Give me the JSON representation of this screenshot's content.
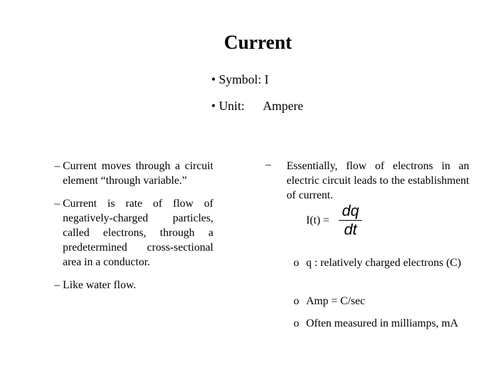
{
  "slide": {
    "title": "Current",
    "top_bullets": [
      {
        "marker": "•",
        "text": "Symbol: I"
      },
      {
        "marker": "•",
        "label": "Unit:",
        "value": "Ampere"
      }
    ],
    "left_column": [
      {
        "marker": "–",
        "text": "Current moves through a circuit element “through variable.”"
      },
      {
        "marker": "–",
        "text": "Current is rate of flow of negatively-charged particles, called electrons, through a predetermined cross-sectional area in a conductor."
      },
      {
        "marker": "–",
        "text": "Like water flow."
      }
    ],
    "right_column": {
      "marker": "–",
      "text": "Essentially, flow of electrons in an electric circuit leads to the establishment of current.",
      "equation": {
        "lhs": "I(t) =",
        "numerator": "dq",
        "denominator": "dt"
      },
      "sub_items": [
        {
          "marker": "o",
          "text": "q : relatively charged electrons (C)"
        },
        {
          "marker": "o",
          "text": "Amp = C/sec"
        },
        {
          "marker": "o",
          "text": "Often measured in milliamps, mA"
        }
      ]
    }
  }
}
